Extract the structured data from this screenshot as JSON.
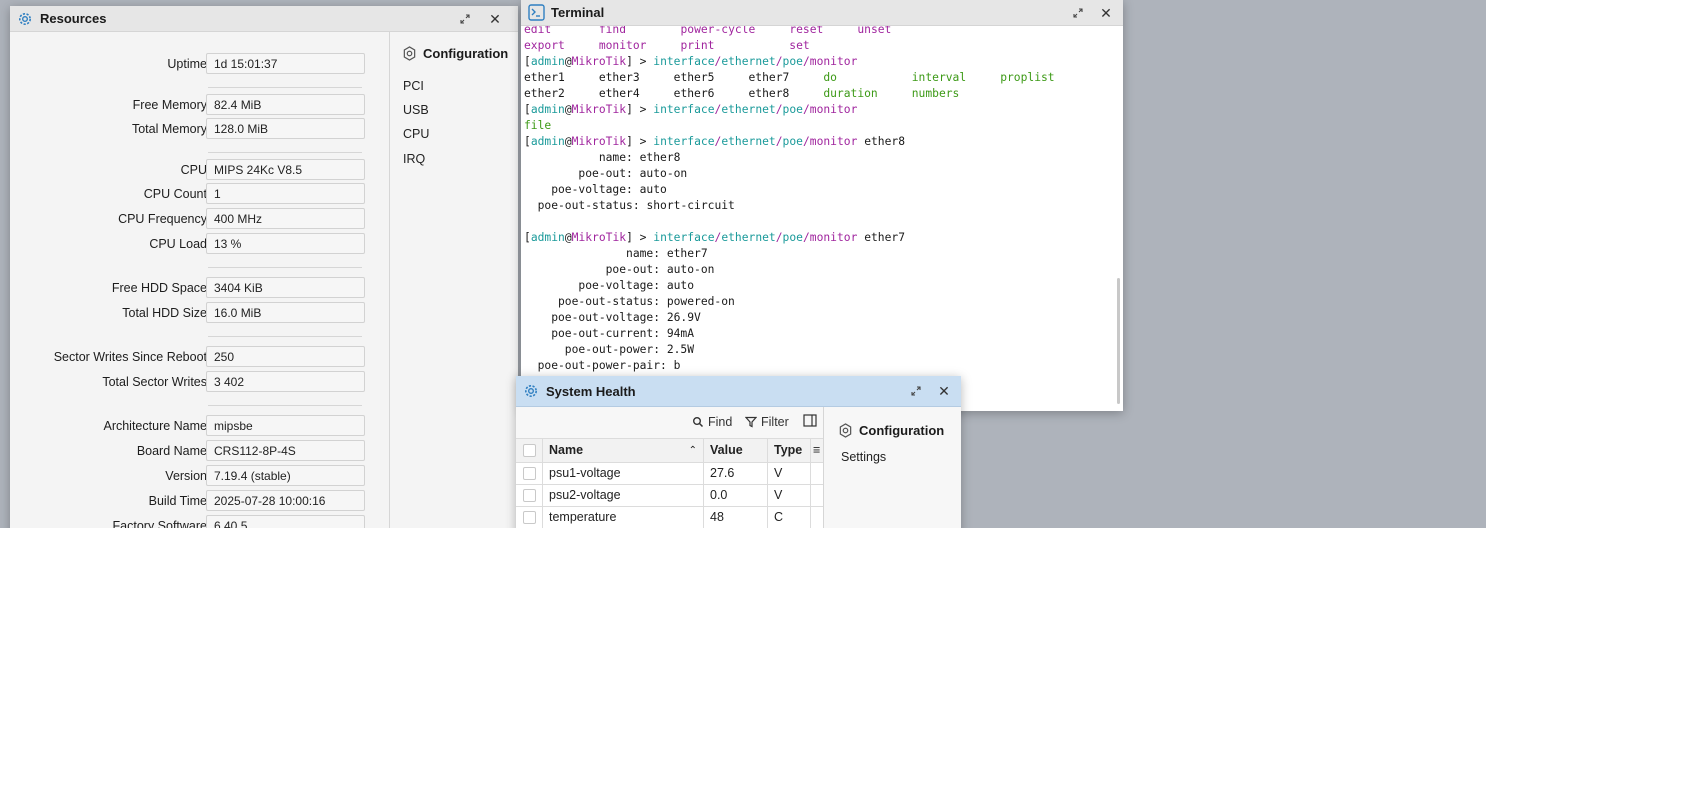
{
  "resources": {
    "title": "Resources",
    "fields": [
      {
        "label": "Uptime",
        "value": "1d 15:01:37"
      },
      {
        "label": "Free Memory",
        "value": "82.4 MiB"
      },
      {
        "label": "Total Memory",
        "value": "128.0 MiB"
      },
      {
        "label": "CPU",
        "value": "MIPS 24Kc V8.5"
      },
      {
        "label": "CPU Count",
        "value": "1"
      },
      {
        "label": "CPU Frequency",
        "value": "400 MHz"
      },
      {
        "label": "CPU Load",
        "value": "13 %"
      },
      {
        "label": "Free HDD Space",
        "value": "3404 KiB"
      },
      {
        "label": "Total HDD Size",
        "value": "16.0 MiB"
      },
      {
        "label": "Sector Writes Since Reboot",
        "value": "250"
      },
      {
        "label": "Total Sector Writes",
        "value": "3 402"
      },
      {
        "label": "Architecture Name",
        "value": "mipsbe"
      },
      {
        "label": "Board Name",
        "value": "CRS112-8P-4S"
      },
      {
        "label": "Version",
        "value": "7.19.4 (stable)"
      },
      {
        "label": "Build Time",
        "value": "2025-07-28 10:00:16"
      },
      {
        "label": "Factory Software",
        "value": "6.40.5"
      }
    ],
    "side": {
      "heading": "Configuration",
      "items": [
        "PCI",
        "USB",
        "CPU",
        "IRQ"
      ]
    }
  },
  "terminal": {
    "title": "Terminal",
    "prompt": {
      "open": "[",
      "user": "admin",
      "at": "@",
      "host": "MikroTik",
      "close": "] > "
    },
    "lines": {
      "l0": [
        "edit",
        "find",
        "power-cycle",
        "reset",
        "unset"
      ],
      "l1": [
        "export",
        "monitor",
        "print",
        "set"
      ],
      "cmd1": "interface/ethernet/poe/monitor",
      "l3": [
        "ether1",
        "ether3",
        "ether5",
        "ether7",
        "do",
        "interval",
        "proplist"
      ],
      "l4": [
        "ether2",
        "ether4",
        "ether6",
        "ether8",
        "duration",
        "numbers"
      ],
      "l6": "file",
      "cmd3_arg": "ether8",
      "out8": [
        {
          "k": "           name: ",
          "v": "ether8"
        },
        {
          "k": "        poe-out: ",
          "v": "auto-on"
        },
        {
          "k": "    poe-voltage: ",
          "v": "auto"
        },
        {
          "k": "  poe-out-status: ",
          "v": "short-circuit"
        }
      ],
      "cmd4_arg": "ether7",
      "out7": [
        {
          "k": "               name: ",
          "v": "ether7"
        },
        {
          "k": "            poe-out: ",
          "v": "auto-on"
        },
        {
          "k": "        poe-voltage: ",
          "v": "auto"
        },
        {
          "k": "     poe-out-status: ",
          "v": "powered-on"
        },
        {
          "k": "    poe-out-voltage: ",
          "v": "26.9V"
        },
        {
          "k": "    poe-out-current: ",
          "v": "94mA"
        },
        {
          "k": "      poe-out-power: ",
          "v": "2.5W"
        },
        {
          "k": "  poe-out-power-pair: ",
          "v": "b"
        }
      ]
    }
  },
  "health": {
    "title": "System Health",
    "toolbar": {
      "find": "Find",
      "filter": "Filter"
    },
    "columns": {
      "name": "Name",
      "value": "Value",
      "type": "Type"
    },
    "rows": [
      {
        "name": "psu1-voltage",
        "value": "27.6",
        "type": "V"
      },
      {
        "name": "psu2-voltage",
        "value": "0.0",
        "type": "V"
      },
      {
        "name": "temperature",
        "value": "48",
        "type": "C"
      }
    ],
    "side": {
      "heading": "Configuration",
      "items": [
        "Settings"
      ]
    }
  }
}
